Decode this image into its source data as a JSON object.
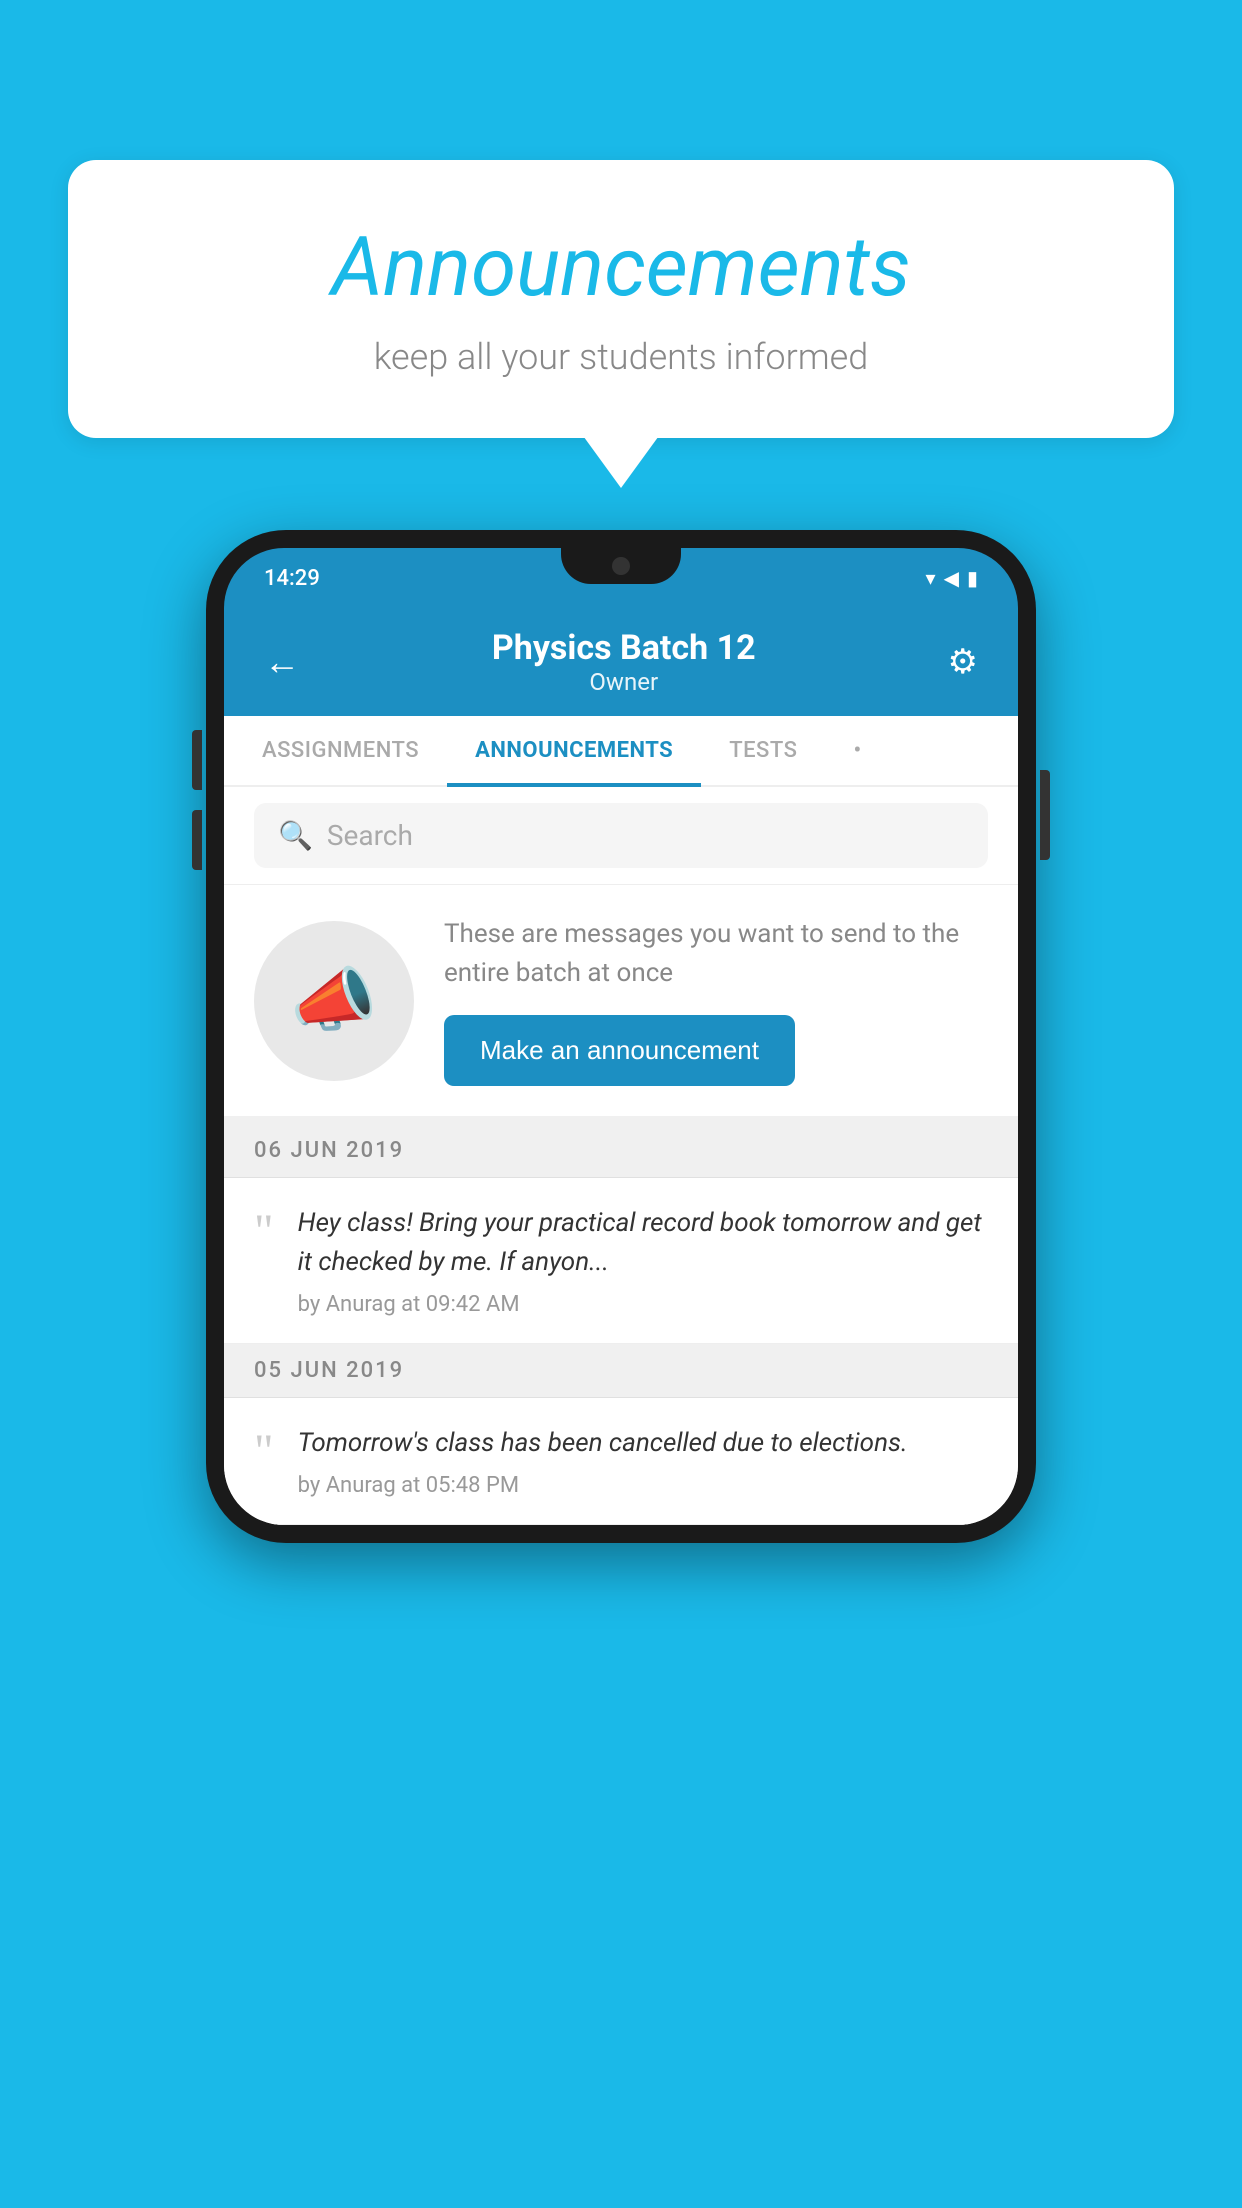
{
  "background_color": "#1ab9e8",
  "speech_bubble": {
    "title": "Announcements",
    "subtitle": "keep all your students informed"
  },
  "phone": {
    "status_bar": {
      "time": "14:29"
    },
    "header": {
      "title": "Physics Batch 12",
      "subtitle": "Owner",
      "back_label": "←"
    },
    "tabs": [
      {
        "label": "ASSIGNMENTS",
        "active": false
      },
      {
        "label": "ANNOUNCEMENTS",
        "active": true
      },
      {
        "label": "TESTS",
        "active": false
      },
      {
        "label": "•",
        "active": false
      }
    ],
    "search": {
      "placeholder": "Search"
    },
    "announcement_prompt": {
      "description": "These are messages you want to send to the entire batch at once",
      "button_label": "Make an announcement"
    },
    "announcements": [
      {
        "date": "06  JUN  2019",
        "text": "Hey class! Bring your practical record book tomorrow and get it checked by me. If anyon...",
        "meta": "by Anurag at 09:42 AM"
      },
      {
        "date": "05  JUN  2019",
        "text": "Tomorrow's class has been cancelled due to elections.",
        "meta": "by Anurag at 05:48 PM"
      }
    ]
  }
}
